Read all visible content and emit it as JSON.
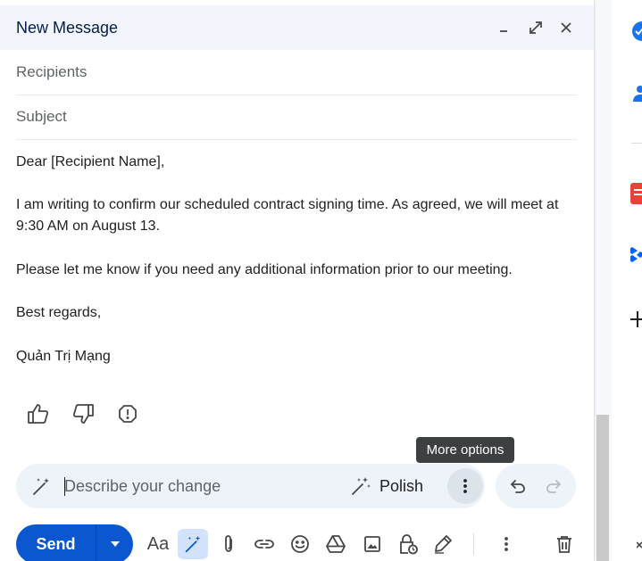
{
  "compose": {
    "title": "New Message",
    "minimize_icon": "minimize-icon",
    "expand_icon": "expand-icon",
    "close_icon": "close-icon"
  },
  "recipients": {
    "placeholder": "Recipients"
  },
  "subject": {
    "placeholder": "Subject"
  },
  "body": {
    "greeting": "Dear [Recipient Name],",
    "paragraph1": "I am writing to confirm our scheduled contract signing time. As agreed, we will meet at 9:30 AM on August 13.",
    "paragraph2": "Please let me know if you need any additional information prior to our meeting.",
    "closing": "Best regards,",
    "signature": "Quản Trị Mạng"
  },
  "feedback": {
    "thumbs_up_icon": "thumbs-up-icon",
    "thumbs_down_icon": "thumbs-down-icon",
    "report_icon": "report-icon"
  },
  "ai_refine": {
    "placeholder": "Describe your change",
    "polish_label": "Polish",
    "tooltip": "More options"
  },
  "toolbar": {
    "send_label": "Send",
    "format_label": "Aa",
    "icons": [
      "help-me-write-icon",
      "attach-icon",
      "link-icon",
      "emoji-icon",
      "drive-icon",
      "photo-icon",
      "confidential-icon",
      "signature-icon",
      "more-icon",
      "trash-icon"
    ]
  },
  "colors": {
    "accent": "#0b57d0",
    "header_bg": "#f2f6fc",
    "tooltip_bg": "#3c4043"
  }
}
